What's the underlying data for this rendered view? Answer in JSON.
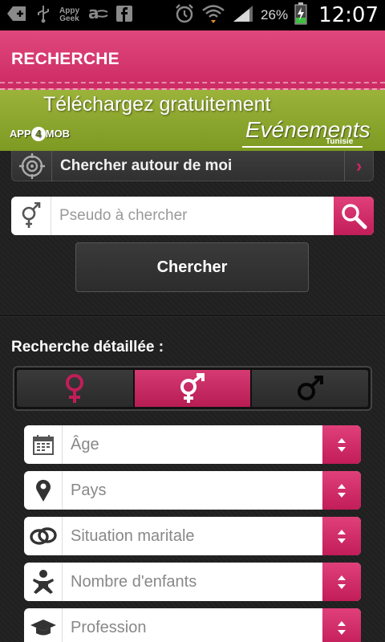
{
  "status_bar": {
    "left_icons": [
      "add-icon",
      "usb-icon",
      "appygeek-icon",
      "amazon-icon",
      "facebook-icon"
    ],
    "appy_text_top": "Appy",
    "appy_text_bottom": "Geek",
    "battery_percent": "26%",
    "time": "12:07"
  },
  "header": {
    "title": "RECHERCHE"
  },
  "banner": {
    "headline": "Téléchargez gratuitement",
    "brand_left": "APP",
    "brand_mid": "4",
    "brand_right": "MOB",
    "event_title": "Evénements",
    "event_sub": "Tunisie"
  },
  "nearby": {
    "label": "Chercher autour de moi"
  },
  "pseudo_search": {
    "placeholder": "Pseudo à chercher",
    "value": ""
  },
  "search_button": {
    "label": "Chercher"
  },
  "detailed": {
    "label": "Recherche détaillée :",
    "gender_options": [
      "female",
      "both",
      "male"
    ],
    "selected_gender": "both",
    "filters": [
      {
        "label": "Âge",
        "icon": "calendar-icon"
      },
      {
        "label": "Pays",
        "icon": "location-pin-icon"
      },
      {
        "label": "Situation maritale",
        "icon": "rings-icon"
      },
      {
        "label": "Nombre d'enfants",
        "icon": "baby-icon"
      },
      {
        "label": "Profession",
        "icon": "graduation-cap-icon"
      }
    ]
  },
  "colors": {
    "accent": "#d6256a",
    "banner_green": "#8ca82c",
    "background": "#202020"
  }
}
